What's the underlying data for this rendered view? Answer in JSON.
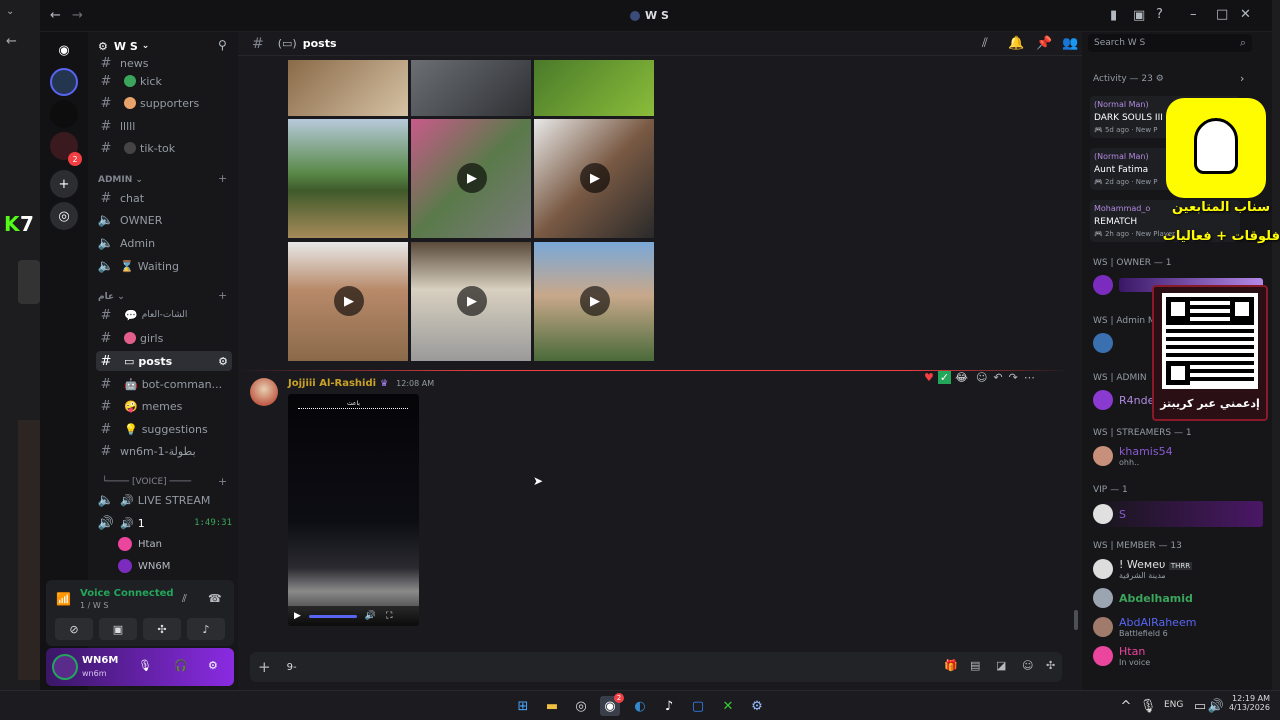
{
  "window": {
    "title": "W S"
  },
  "server": {
    "name": "W S"
  },
  "header": {
    "channel": "posts",
    "search_placeholder": "Search W S"
  },
  "channels": [
    {
      "label": "news"
    },
    {
      "label": "kick"
    },
    {
      "label": "supporters"
    },
    {
      "label": "lllll"
    },
    {
      "label": "tik-tok"
    }
  ],
  "admin_category": "ADMIN",
  "admin_channels": [
    {
      "label": "chat"
    },
    {
      "label": "OWNER"
    },
    {
      "label": "Admin"
    },
    {
      "label": "Waiting"
    }
  ],
  "general_category": "عام",
  "general_channels": [
    {
      "label": "الشات-العام"
    },
    {
      "label": "girls"
    },
    {
      "label": "posts"
    },
    {
      "label": "bot-comman..."
    },
    {
      "label": "memes"
    },
    {
      "label": "suggestions"
    },
    {
      "label": "wn6m-1-بطولة"
    }
  ],
  "voice_category": "[VOICE]",
  "voice_channels": [
    {
      "label": "LIVE STREAM"
    },
    {
      "label": "1",
      "timer": "1:49:31"
    }
  ],
  "voice_users": [
    {
      "name": "Htan"
    },
    {
      "name": "WN6M"
    }
  ],
  "voice_panel": {
    "status": "Voice Connected",
    "channel": "1 / W S"
  },
  "user": {
    "name": "WN6M",
    "tag": "wn6m"
  },
  "message": {
    "author": "Jojjiii Al-Rashidi",
    "time": "12:08 AM",
    "overlay_text": "باعت"
  },
  "composer": {
    "value": "9-"
  },
  "members": {
    "activity": "Activity — 23",
    "act_items": [
      {
        "tag": "(Normal Man)",
        "title": "DARK SOULS III",
        "ago": "5d ago",
        "extra": "New P"
      },
      {
        "tag": "(Normal Man)",
        "title": "Aunt Fatima",
        "ago": "2d ago",
        "extra": "New P"
      },
      {
        "tag": "Mohammad_o",
        "title": "REMATCH",
        "ago": "2h ago",
        "extra": "New Player"
      }
    ],
    "owner_head": "WS | OWNER — 1",
    "admin_m_head": "WS | Admin M",
    "admin_head": "WS | ADMIN",
    "admin_name": "R4nde",
    "streamers_head": "WS | STREAMERS — 1",
    "streamer": {
      "name": "khamis54",
      "sub": "ohh.."
    },
    "vip_head": "VIP — 1",
    "vip": {
      "name": "S"
    },
    "member_head": "WS | MEMBER — 13",
    "list": [
      {
        "name": "! Weмeυ",
        "badge": "THRR",
        "sub": "مدينة الشرقية",
        "color": "#e0e0e0"
      },
      {
        "name": "Abdelhamid",
        "sub": "",
        "color": "#3ba55c"
      },
      {
        "name": "AbdAlRaheem",
        "sub": "Battlefield 6",
        "color": "#5865f2"
      },
      {
        "name": "Htan",
        "sub": "In voice",
        "color": "#eb459e"
      }
    ]
  },
  "promo": {
    "line1": "سناب المتابعين",
    "line2": "فلوقات + فعاليات",
    "qr_caption": "إدعمني عبر كريبتز"
  },
  "taskbar": {
    "lang": "ENG",
    "time": "12:19 AM",
    "date": "4/13/2026",
    "badge": "2"
  },
  "colors": {
    "accent": "#5865f2",
    "online": "#23a55a",
    "snap": "#fffc00",
    "purple": "#8a2be2"
  }
}
